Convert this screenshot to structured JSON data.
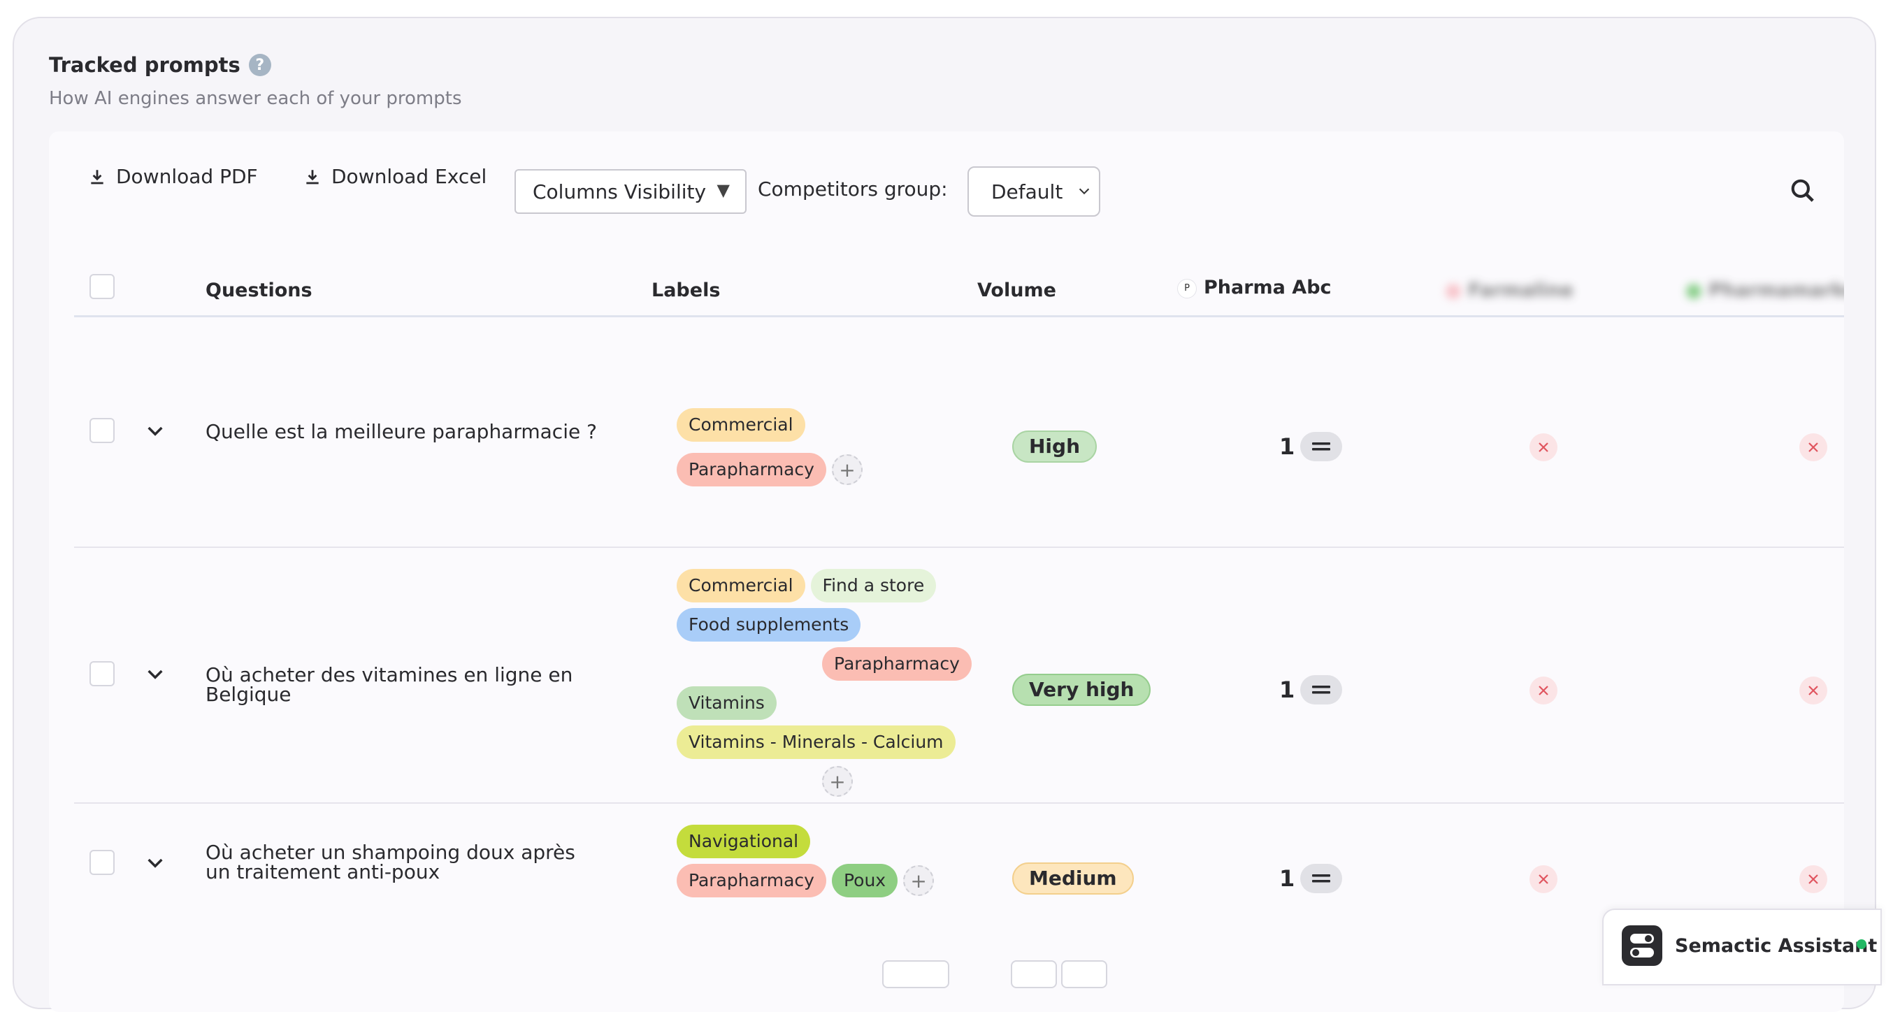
{
  "header": {
    "title": "Tracked prompts",
    "help_glyph": "?",
    "subtitle": "How AI engines answer each of your prompts"
  },
  "toolbar": {
    "download_pdf": "Download PDF",
    "download_excel": "Download Excel",
    "columns_visibility": "Columns Visibility",
    "columns_caret": "▼",
    "competitors_label": "Competitors group:",
    "competitors_value": "Default"
  },
  "table": {
    "columns": {
      "questions": "Questions",
      "labels": "Labels",
      "volume": "Volume",
      "brand": "Pharma Abc",
      "brand_initial": "P",
      "competitor_1": "Farmaline",
      "competitor_2": "Pharmamarket"
    },
    "rows": [
      {
        "question": "Quelle est la meilleure parapharmacie ?",
        "labels": [
          {
            "text": "Commercial",
            "color": "#fde0a7"
          },
          {
            "text": "Parapharmacy",
            "color": "#fbbdb3"
          }
        ],
        "volume": "High",
        "volume_color": "#c8e6c4",
        "rank": "1"
      },
      {
        "question": "Où acheter des vitamines en ligne en Belgique",
        "labels": [
          {
            "text": "Commercial",
            "color": "#fde0a7"
          },
          {
            "text": "Find a store",
            "color": "#e5f3da"
          },
          {
            "text": "Food supplements",
            "color": "#a9cdf8"
          },
          {
            "text": "Parapharmacy",
            "color": "#fbbdb3"
          },
          {
            "text": "Vitamins",
            "color": "#bfe0b8"
          },
          {
            "text": "Vitamins - Minerals - Calcium",
            "color": "#ecec95"
          }
        ],
        "volume": "Very high",
        "volume_color": "#b7e0b0",
        "rank": "1"
      },
      {
        "question": "Où acheter un shampoing doux après un traitement anti-poux",
        "labels": [
          {
            "text": "Navigational",
            "color": "#c4dc3c"
          },
          {
            "text": "Parapharmacy",
            "color": "#fbbdb3"
          },
          {
            "text": "Poux",
            "color": "#8ece82"
          }
        ],
        "volume": "Medium",
        "volume_color": "#fde6bd",
        "rank": "1"
      }
    ]
  },
  "assistant": {
    "name": "Semactic Assistant"
  },
  "colors": {
    "accent_blue": "#a6b5c4",
    "online": "#22b864",
    "x_red": "#e0555f",
    "competitor_1_dot": "#f7b6bd",
    "competitor_2_dot": "#6cc46c"
  }
}
